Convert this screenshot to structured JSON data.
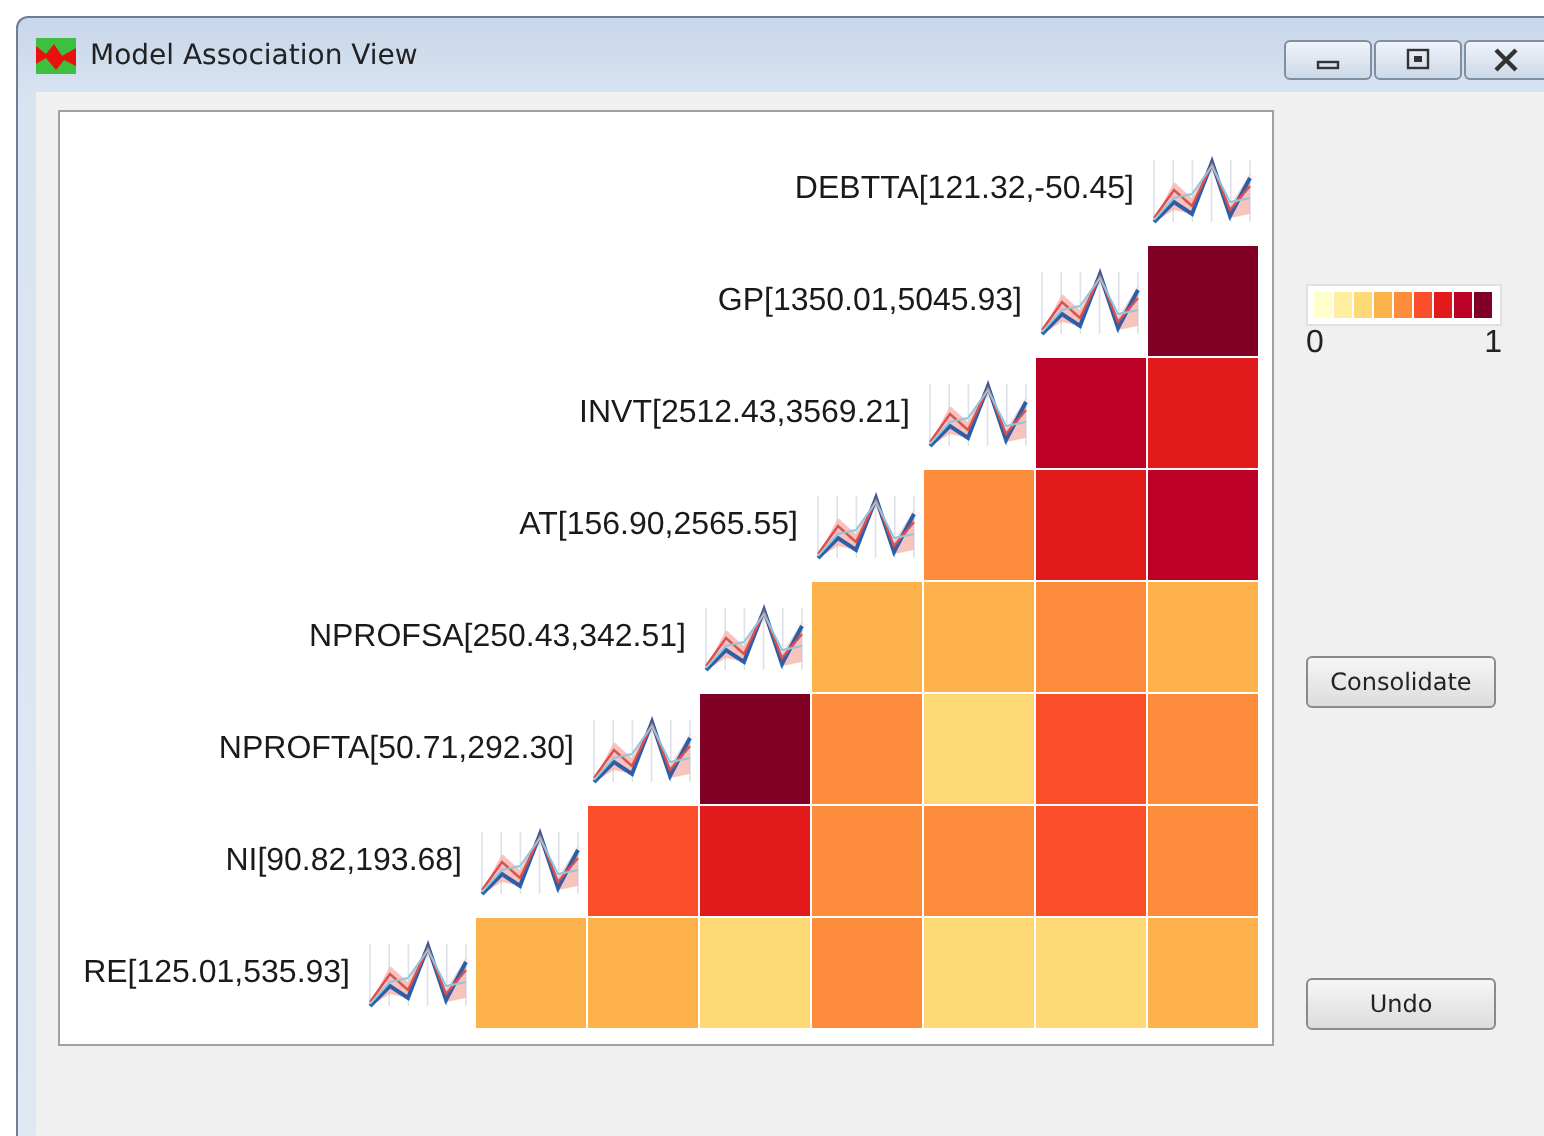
{
  "window": {
    "title": "Model Association View"
  },
  "matrix": {
    "rows": [
      {
        "label": "DEBTTA[121.32,-50.45]"
      },
      {
        "label": "GP[1350.01,5045.93]",
        "cells": [
          {
            "color": "#800026"
          }
        ]
      },
      {
        "label": "INVT[2512.43,3569.21]",
        "cells": [
          {
            "color": "#bd0026"
          },
          {
            "color": "#e31a1c"
          }
        ]
      },
      {
        "label": "AT[156.90,2565.55]",
        "cells": [
          {
            "color": "#fd8d3c"
          },
          {
            "color": "#e31a1c"
          },
          {
            "color": "#bd0026"
          }
        ]
      },
      {
        "label": "NPROFSA[250.43,342.51]",
        "cells": [
          {
            "color": "#feb24c"
          },
          {
            "color": "#feb24c"
          },
          {
            "color": "#fd8d3c"
          },
          {
            "color": "#feb24c"
          }
        ]
      },
      {
        "label": "NPROFTA[50.71,292.30]",
        "cells": [
          {
            "color": "#800026"
          },
          {
            "color": "#fd8d3c"
          },
          {
            "color": "#fed976"
          },
          {
            "color": "#fc4e2a"
          },
          {
            "color": "#fd8d3c"
          }
        ]
      },
      {
        "label": "NI[90.82,193.68]",
        "cells": [
          {
            "color": "#fc4e2a"
          },
          {
            "color": "#e31a1c"
          },
          {
            "color": "#fd8d3c"
          },
          {
            "color": "#fd8d3c"
          },
          {
            "color": "#fc4e2a"
          },
          {
            "color": "#fd8d3c"
          }
        ]
      },
      {
        "label": "RE[125.01,535.93]",
        "cells": [
          {
            "color": "#feb24c"
          },
          {
            "color": "#feb24c"
          },
          {
            "color": "#fed976"
          },
          {
            "color": "#fd8d3c"
          },
          {
            "color": "#fed976"
          },
          {
            "color": "#fed976"
          },
          {
            "color": "#feb24c"
          }
        ]
      }
    ]
  },
  "legend": {
    "colors": [
      {
        "color": "#ffffcc"
      },
      {
        "color": "#ffeda0"
      },
      {
        "color": "#fed976"
      },
      {
        "color": "#feb24c"
      },
      {
        "color": "#fd8d3c"
      },
      {
        "color": "#fc4e2a"
      },
      {
        "color": "#e31a1c"
      },
      {
        "color": "#bd0026"
      },
      {
        "color": "#800026"
      }
    ],
    "min_label": "0",
    "max_label": "1"
  },
  "buttons": [
    {
      "label": "Consolidate"
    },
    {
      "label": "Undo"
    }
  ]
}
